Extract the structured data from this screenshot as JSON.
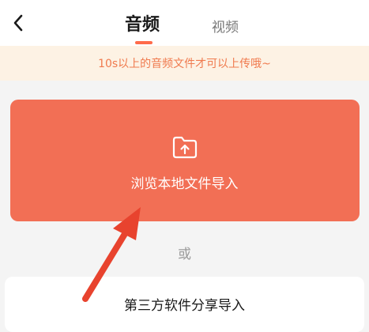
{
  "header": {
    "tabs": [
      {
        "label": "音频",
        "active": true
      },
      {
        "label": "视频",
        "active": false
      }
    ]
  },
  "notice": {
    "text": "10s以上的音频文件才可以上传哦~"
  },
  "main_card": {
    "label": "浏览本地文件导入",
    "icon": "folder-upload-icon"
  },
  "divider": {
    "text": "或"
  },
  "secondary_card": {
    "label": "第三方软件分享导入"
  },
  "colors": {
    "accent": "#f26f55",
    "notice_bg": "#fdf2e4",
    "notice_text": "#f07a4e",
    "arrow": "#e8432e"
  }
}
